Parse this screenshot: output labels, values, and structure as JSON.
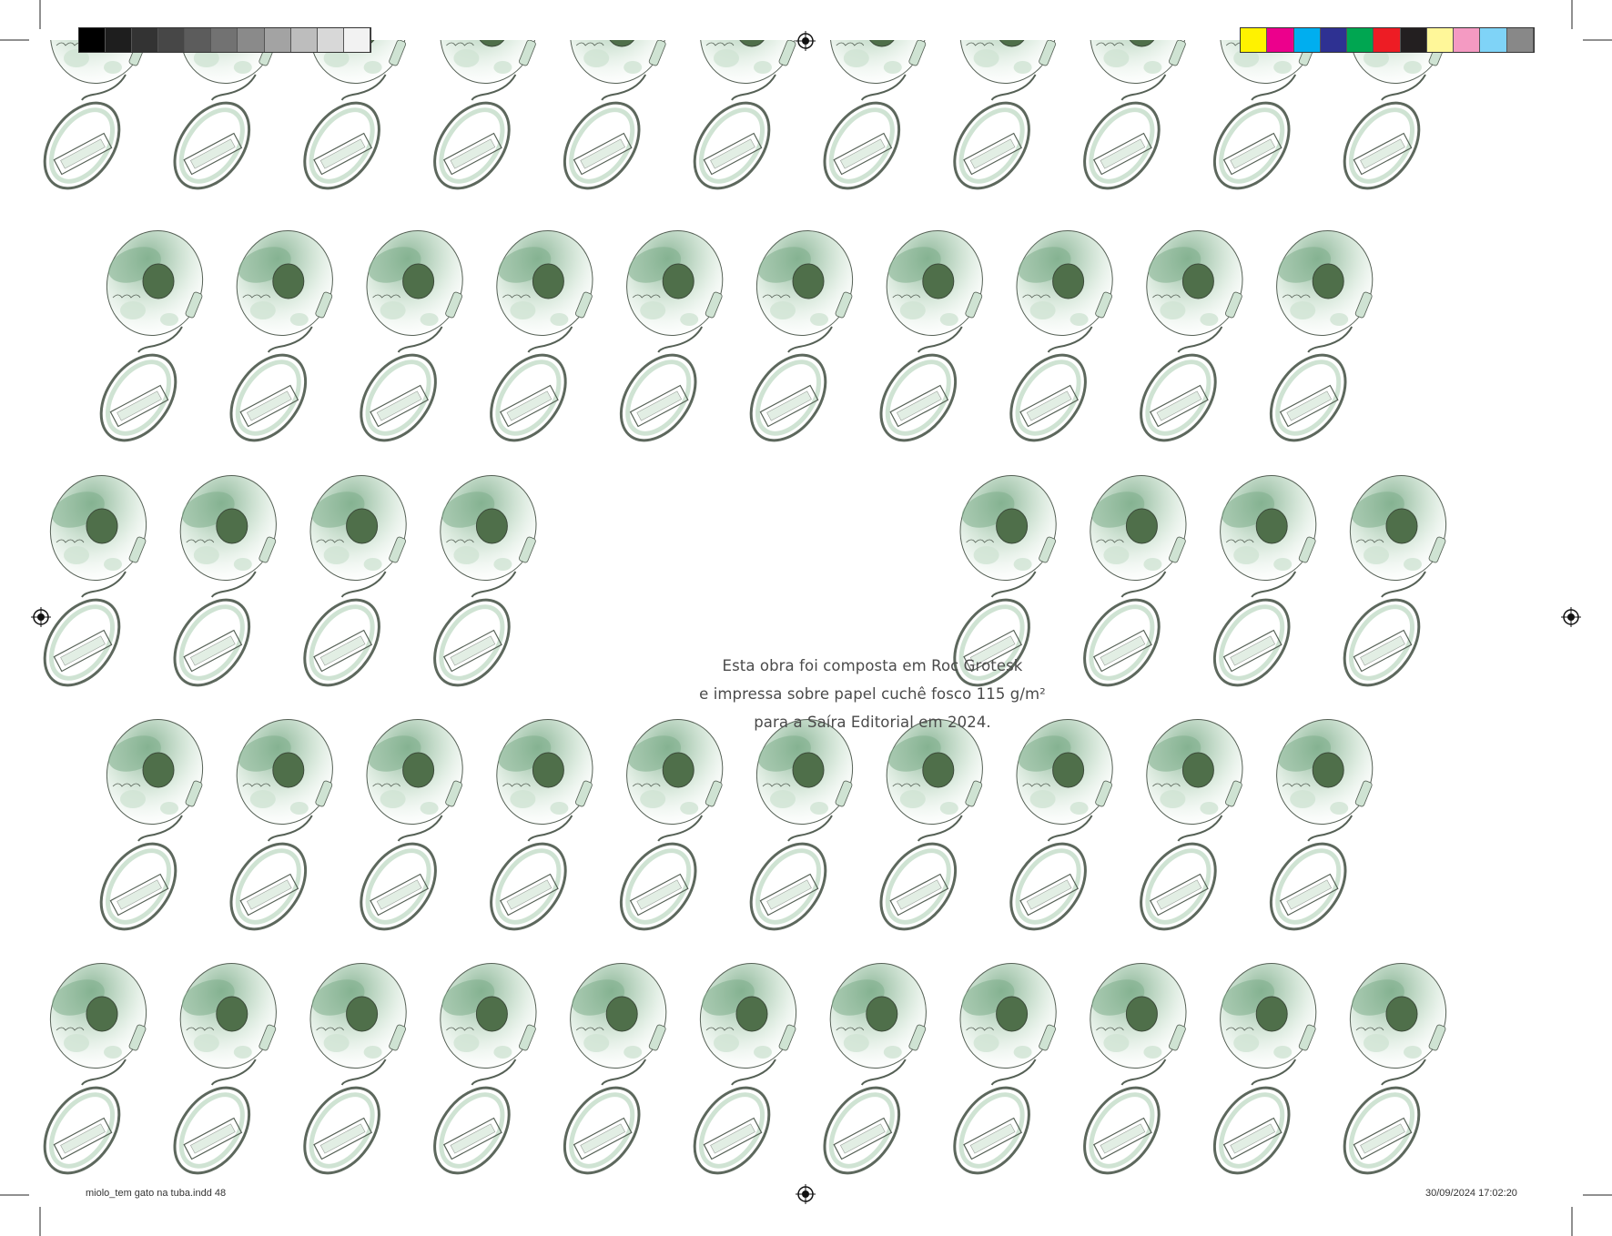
{
  "colophon": {
    "line1": "Esta obra foi composta em Roc Grotesk",
    "line2": "e impressa sobre papel cuchê fosco 115 g/m²",
    "line3": "para a Saíra Editorial em 2024."
  },
  "slug": {
    "file": "miolo_tem gato na tuba.indd   48",
    "datetime": "30/09/2024   17:02:20"
  },
  "colors": {
    "grayscale": [
      "#000000",
      "#1e1e1e",
      "#333333",
      "#474747",
      "#5c5c5c",
      "#727272",
      "#8a8a8a",
      "#a3a3a3",
      "#bdbdbd",
      "#d8d8d8",
      "#f2f2f2"
    ],
    "process": [
      "#fff200",
      "#ec008c",
      "#00aeef",
      "#2e3192",
      "#00a651",
      "#ed1c24",
      "#231f20",
      "#fff799",
      "#f49ac2",
      "#7fd3f7",
      "#888888"
    ],
    "tuba_light": "#cfe3d3",
    "tuba_mid": "#7fae8c",
    "tuba_dark": "#4f6f4a",
    "outline": "#556055"
  },
  "illustration": {
    "icon": "sousaphone-watercolor",
    "rows": [
      {
        "count": 11,
        "offset": "left"
      },
      {
        "count": 10,
        "offset": "right"
      },
      {
        "count": 11,
        "offset": "left",
        "gap_from": 4,
        "gap_to": 7
      },
      {
        "count": 10,
        "offset": "right"
      },
      {
        "count": 11,
        "offset": "left"
      }
    ]
  }
}
